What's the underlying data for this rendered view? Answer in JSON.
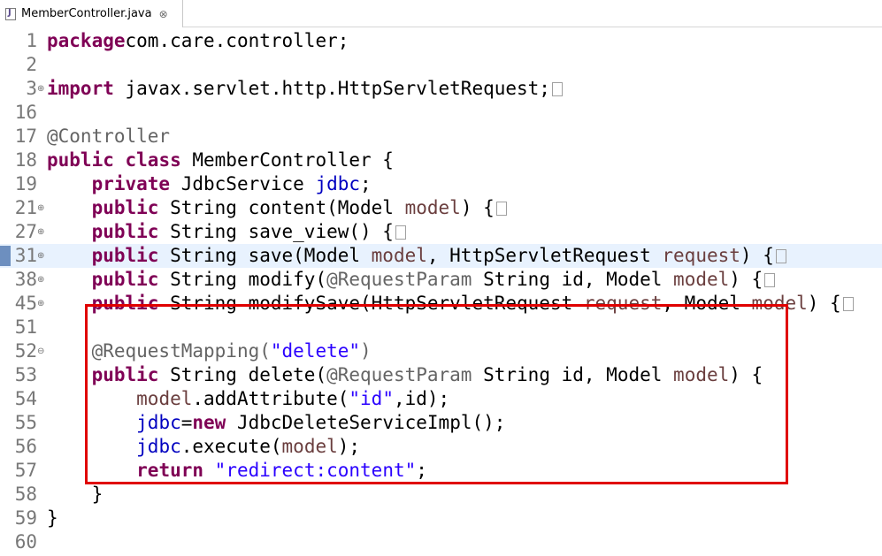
{
  "tab": {
    "filename": "MemberController.java",
    "close_glyph": "⊗"
  },
  "lines": [
    {
      "num": "1",
      "parts": [
        [
          "kw",
          "package"
        ],
        [
          "",
          "com.care.controller;"
        ]
      ]
    },
    {
      "num": "2",
      "parts": []
    },
    {
      "num": "3",
      "fold": "⊕",
      "parts": [
        [
          "kw",
          "import"
        ],
        [
          "",
          " javax.servlet.http.HttpServletRequest;"
        ]
      ],
      "collapsed": true
    },
    {
      "num": "16",
      "parts": []
    },
    {
      "num": "17",
      "parts": [
        [
          "ann",
          "@Controller"
        ]
      ]
    },
    {
      "num": "18",
      "parts": [
        [
          "kw",
          "public"
        ],
        [
          "",
          " "
        ],
        [
          "kw",
          "class"
        ],
        [
          "",
          " MemberController {"
        ]
      ]
    },
    {
      "num": "19",
      "parts": [
        [
          "",
          "    "
        ],
        [
          "kw",
          "private"
        ],
        [
          "",
          " JdbcService "
        ],
        [
          "fld",
          "jdbc"
        ],
        [
          "",
          ";"
        ]
      ]
    },
    {
      "num": "21",
      "fold": "⊕",
      "parts": [
        [
          "",
          "    "
        ],
        [
          "kw",
          "public"
        ],
        [
          "",
          " String content(Model "
        ],
        [
          "var",
          "model"
        ],
        [
          "",
          ") {"
        ]
      ],
      "collapsed": true
    },
    {
      "num": "27",
      "fold": "⊕",
      "parts": [
        [
          "",
          "    "
        ],
        [
          "kw",
          "public"
        ],
        [
          "",
          " String save_view() {"
        ]
      ],
      "collapsed": true
    },
    {
      "num": "31",
      "fold": "⊕",
      "current": true,
      "parts": [
        [
          "",
          "    "
        ],
        [
          "kw",
          "public"
        ],
        [
          "",
          " String save(Model "
        ],
        [
          "var",
          "model"
        ],
        [
          "",
          ", HttpServletRequest "
        ],
        [
          "var",
          "request"
        ],
        [
          "",
          ") {"
        ]
      ],
      "collapsed": true
    },
    {
      "num": "38",
      "fold": "⊕",
      "parts": [
        [
          "",
          "    "
        ],
        [
          "kw",
          "public"
        ],
        [
          "",
          " String modify("
        ],
        [
          "ann",
          "@RequestParam"
        ],
        [
          "",
          " String id, Model "
        ],
        [
          "var",
          "model"
        ],
        [
          "",
          ") {"
        ]
      ],
      "collapsed": true
    },
    {
      "num": "45",
      "fold": "⊕",
      "parts": [
        [
          "",
          "    "
        ],
        [
          "kw",
          "public"
        ],
        [
          "",
          " String modifySave(HttpServletRequest "
        ],
        [
          "var",
          "request"
        ],
        [
          "",
          ", Model "
        ],
        [
          "var",
          "model"
        ],
        [
          "",
          ") {"
        ]
      ],
      "collapsed": true
    },
    {
      "num": "51",
      "parts": []
    },
    {
      "num": "52",
      "fold": "⊖",
      "parts": [
        [
          "",
          "    "
        ],
        [
          "ann",
          "@RequestMapping("
        ],
        [
          "str",
          "\"delete\""
        ],
        [
          "ann",
          ")"
        ]
      ]
    },
    {
      "num": "53",
      "parts": [
        [
          "",
          "    "
        ],
        [
          "kw",
          "public"
        ],
        [
          "",
          " String delete("
        ],
        [
          "ann",
          "@RequestParam"
        ],
        [
          "",
          " String id, Model "
        ],
        [
          "var",
          "model"
        ],
        [
          "",
          ") {"
        ]
      ]
    },
    {
      "num": "54",
      "parts": [
        [
          "",
          "        "
        ],
        [
          "var",
          "model"
        ],
        [
          "",
          ".addAttribute("
        ],
        [
          "str",
          "\"id\""
        ],
        [
          "",
          ",id);"
        ]
      ]
    },
    {
      "num": "55",
      "parts": [
        [
          "",
          "        "
        ],
        [
          "fld",
          "jdbc"
        ],
        [
          "",
          "="
        ],
        [
          "kw",
          "new"
        ],
        [
          "",
          " JdbcDeleteServiceImpl();"
        ]
      ]
    },
    {
      "num": "56",
      "parts": [
        [
          "",
          "        "
        ],
        [
          "fld",
          "jdbc"
        ],
        [
          "",
          ".execute("
        ],
        [
          "var",
          "model"
        ],
        [
          "",
          ");"
        ]
      ]
    },
    {
      "num": "57",
      "parts": [
        [
          "",
          "        "
        ],
        [
          "kw",
          "return"
        ],
        [
          "",
          " "
        ],
        [
          "str",
          "\"redirect:content\""
        ],
        [
          "",
          ";"
        ]
      ]
    },
    {
      "num": "58",
      "parts": [
        [
          "",
          "    }"
        ]
      ]
    },
    {
      "num": "59",
      "parts": [
        [
          "",
          "}"
        ]
      ]
    },
    {
      "num": "60",
      "parts": []
    }
  ]
}
